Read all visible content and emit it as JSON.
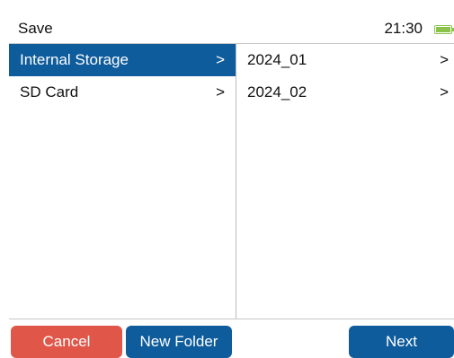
{
  "header": {
    "title": "Save",
    "time": "21:30",
    "battery_icon": "battery-icon"
  },
  "left_pane": {
    "items": [
      {
        "label": "Internal Storage",
        "chevron": ">",
        "selected": true
      },
      {
        "label": "SD Card",
        "chevron": ">",
        "selected": false
      }
    ]
  },
  "right_pane": {
    "items": [
      {
        "label": "2024_01",
        "chevron": ">"
      },
      {
        "label": "2024_02",
        "chevron": ">"
      }
    ]
  },
  "footer": {
    "cancel_label": "Cancel",
    "new_folder_label": "New Folder",
    "next_label": "Next"
  },
  "colors": {
    "accent": "#0f5c9c",
    "cancel": "#e0574a",
    "battery": "#8bc34a"
  }
}
